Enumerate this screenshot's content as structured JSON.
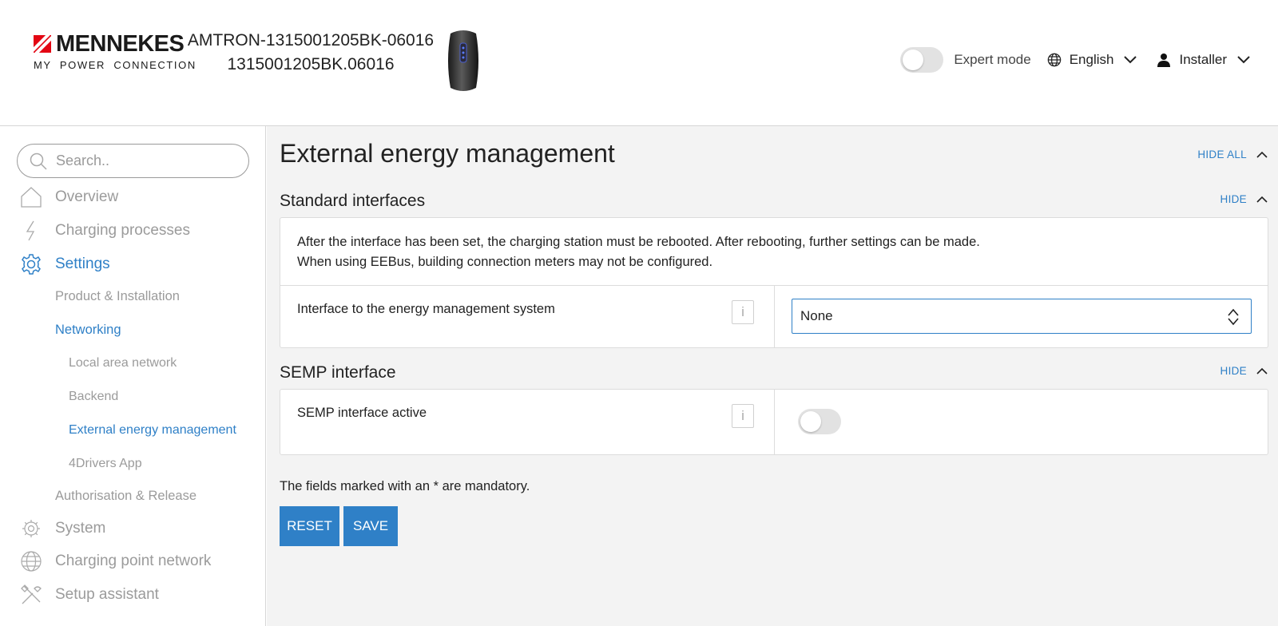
{
  "header": {
    "logo_name": "MENNEKES",
    "logo_tagline": "MY  POWER  CONNECTION",
    "device_name": "AMTRON-1315001205BK-06016",
    "device_serial": "1315001205BK.06016",
    "expert_mode_label": "Expert mode",
    "expert_mode_on": false,
    "language": "English",
    "user_role": "Installer"
  },
  "sidebar": {
    "search_placeholder": "Search..",
    "items": {
      "overview": "Overview",
      "charging_processes": "Charging processes",
      "settings": "Settings",
      "product_installation": "Product & Installation",
      "networking": "Networking",
      "local_area_network": "Local area network",
      "backend": "Backend",
      "external_energy_management": "External energy management",
      "drivers_app": "4Drivers App",
      "authorisation_release": "Authorisation & Release",
      "system": "System",
      "charging_point_network": "Charging point network",
      "setup_assistant": "Setup assistant"
    }
  },
  "main": {
    "title": "External energy management",
    "hide_all_label": "HIDE ALL",
    "standard_interfaces": {
      "title": "Standard interfaces",
      "hide_label": "HIDE",
      "note_line1": "After the interface has been set, the charging station must be rebooted. After rebooting, further settings can be made.",
      "note_line2": "When using EEBus, building connection meters may not be configured.",
      "interface_label": "Interface to the energy management system",
      "info_label": "i",
      "interface_value": "None"
    },
    "semp": {
      "title": "SEMP interface",
      "hide_label": "HIDE",
      "active_label": "SEMP interface active",
      "info_label": "i",
      "active": false
    },
    "mandatory_note": "The fields marked with an * are mandatory.",
    "reset_label": "RESET",
    "save_label": "SAVE"
  },
  "colors": {
    "accent": "#2f80c7",
    "brand_red": "#e30613",
    "muted_text": "#9b9b9b",
    "main_bg": "#f3f3f3"
  }
}
